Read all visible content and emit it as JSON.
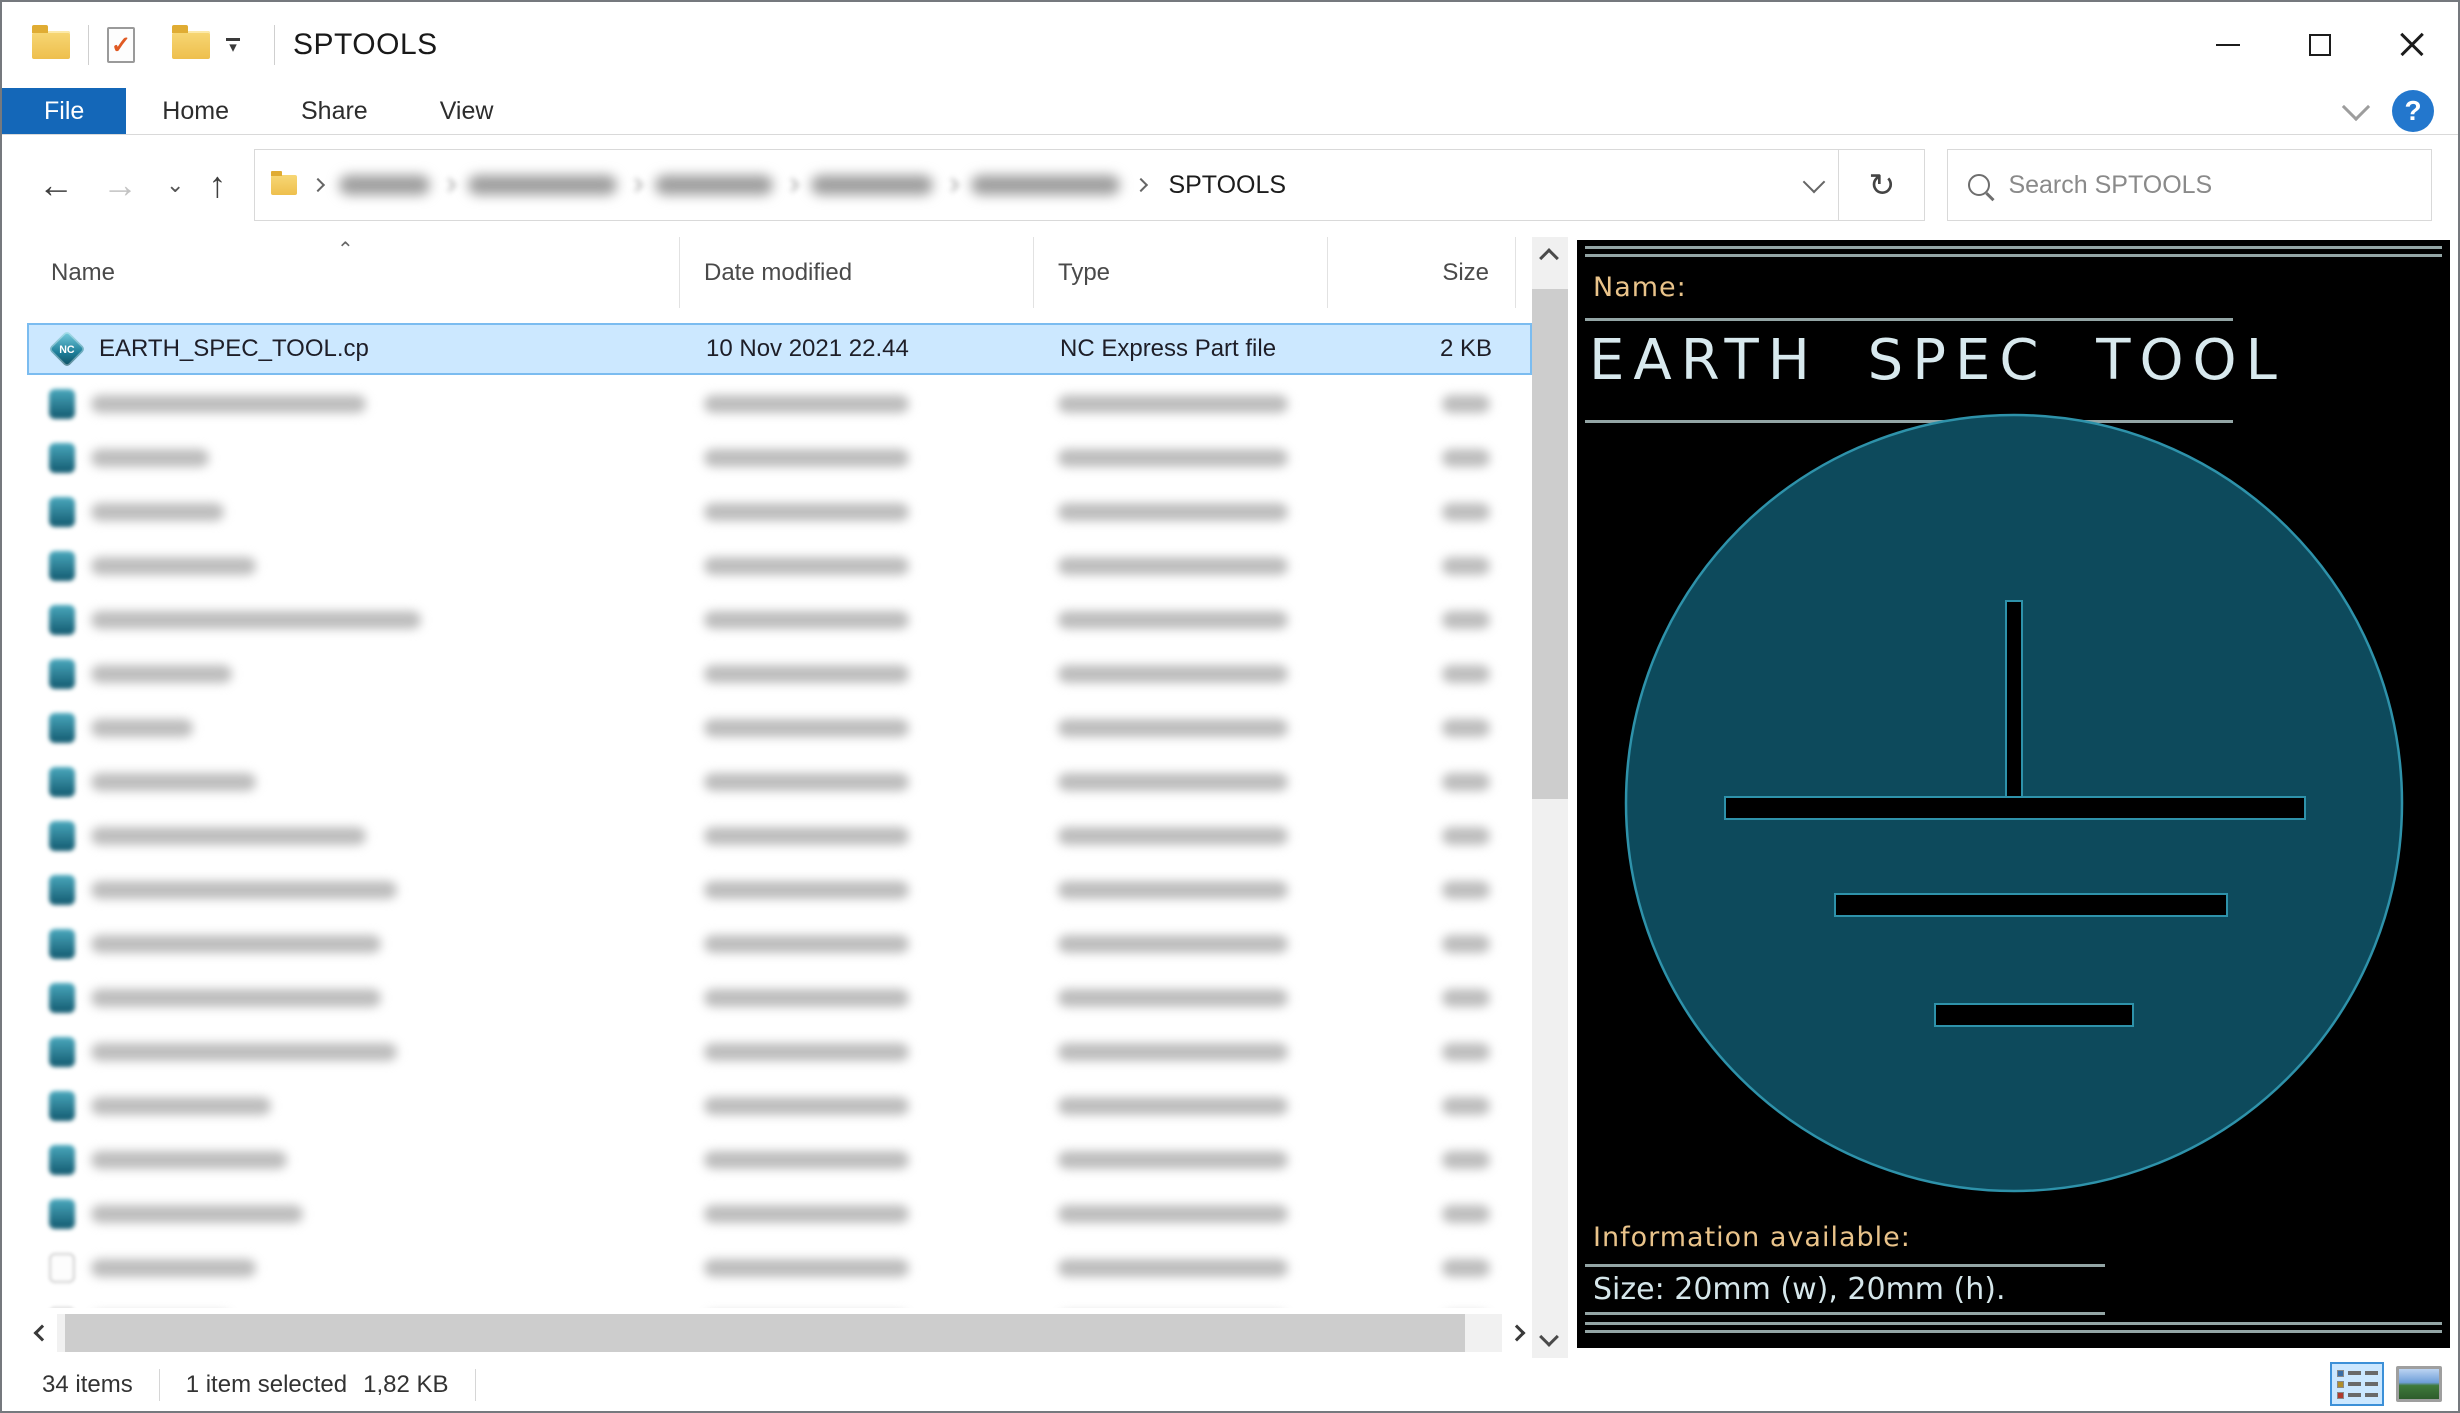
{
  "window": {
    "title": "SPTOOLS"
  },
  "icons": {
    "qat_check_glyph": "✓",
    "qat_dropdown_glyph": "▾",
    "back_glyph": "←",
    "forward_glyph": "→",
    "up_glyph": "↑",
    "nav_recent_glyph": "⌄",
    "refresh_glyph": "↻",
    "help_glyph": "?",
    "sort_caret_glyph": "⌃"
  },
  "ribbon": {
    "tabs": [
      {
        "label": "File",
        "active": true
      },
      {
        "label": "Home",
        "active": false
      },
      {
        "label": "Share",
        "active": false
      },
      {
        "label": "View",
        "active": false
      }
    ]
  },
  "address": {
    "leaf": "SPTOOLS",
    "redacted_segment_widths": [
      91,
      149,
      118,
      122,
      149
    ]
  },
  "search": {
    "placeholder": "Search SPTOOLS"
  },
  "list": {
    "columns": [
      "Name",
      "Date modified",
      "Type",
      "Size"
    ],
    "selected_file": {
      "icon_text": "NC",
      "name": "EARTH_SPEC_TOOL.cp",
      "date_modified": "10 Nov 2021 22.44",
      "type": "NC Express Part file",
      "size": "2 KB"
    },
    "redacted_rows": [
      {
        "name_w": 275,
        "icon": "teal"
      },
      {
        "name_w": 118,
        "icon": "teal"
      },
      {
        "name_w": 133,
        "icon": "teal"
      },
      {
        "name_w": 165,
        "icon": "teal"
      },
      {
        "name_w": 330,
        "icon": "teal"
      },
      {
        "name_w": 141,
        "icon": "teal"
      },
      {
        "name_w": 102,
        "icon": "teal"
      },
      {
        "name_w": 165,
        "icon": "teal"
      },
      {
        "name_w": 275,
        "icon": "teal"
      },
      {
        "name_w": 306,
        "icon": "teal"
      },
      {
        "name_w": 290,
        "icon": "teal"
      },
      {
        "name_w": 290,
        "icon": "teal"
      },
      {
        "name_w": 306,
        "icon": "teal"
      },
      {
        "name_w": 180,
        "icon": "teal"
      },
      {
        "name_w": 196,
        "icon": "teal"
      },
      {
        "name_w": 212,
        "icon": "teal"
      },
      {
        "name_w": 165,
        "icon": "pale"
      },
      {
        "name_w": 141,
        "icon": "pale"
      }
    ]
  },
  "preview": {
    "name_label": "Name:",
    "part_name": "EARTH SPEC TOOL",
    "info_label": "Information available:",
    "info_text": "Size: 20mm (w), 20mm (h).",
    "colors": {
      "background": "#000000",
      "label": "#e9c38a",
      "text": "#d8e9ee",
      "line": "#93a5a5",
      "symbol_fill": "#0d4a5c",
      "symbol_stroke": "#2e92aa"
    }
  },
  "status": {
    "items_count": "34 items",
    "selection": "1 item selected",
    "selection_size": "1,82 KB"
  },
  "colors": {
    "accent_blue": "#1467b8",
    "selection_bg": "#cce8ff",
    "selection_border": "#7bbcf0",
    "help_blue": "#2377cd"
  }
}
